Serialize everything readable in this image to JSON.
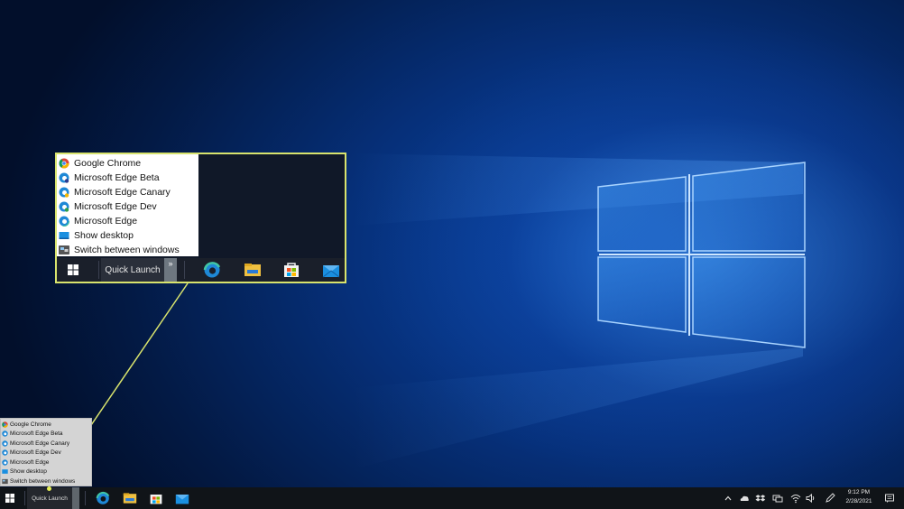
{
  "quick_launch_menu": {
    "items": [
      {
        "label": "Google Chrome",
        "icon": "chrome-icon"
      },
      {
        "label": "Microsoft Edge Beta",
        "icon": "edge-beta-icon"
      },
      {
        "label": "Microsoft Edge Canary",
        "icon": "edge-canary-icon"
      },
      {
        "label": "Microsoft Edge Dev",
        "icon": "edge-dev-icon"
      },
      {
        "label": "Microsoft Edge",
        "icon": "edge-icon"
      },
      {
        "label": "Show desktop",
        "icon": "show-desktop-icon"
      },
      {
        "label": "Switch between windows",
        "icon": "switch-windows-icon"
      }
    ]
  },
  "taskbar": {
    "toolbar_label": "Quick Launch",
    "overflow_glyph": "»",
    "pinned_apps": [
      "edge-icon",
      "file-explorer-icon",
      "microsoft-store-icon",
      "mail-icon"
    ],
    "tray_icons": [
      "chevron-up-icon",
      "onedrive-icon",
      "dropbox-icon",
      "network-icon",
      "wifi-icon",
      "volume-icon",
      "pen-icon"
    ],
    "clock": {
      "time": "9:12 PM",
      "date": "2/28/2021"
    }
  },
  "colors": {
    "callout_border": "#d8e36d",
    "taskbar_bg": "#101418",
    "desktop_blue": "#0b4cb0"
  }
}
